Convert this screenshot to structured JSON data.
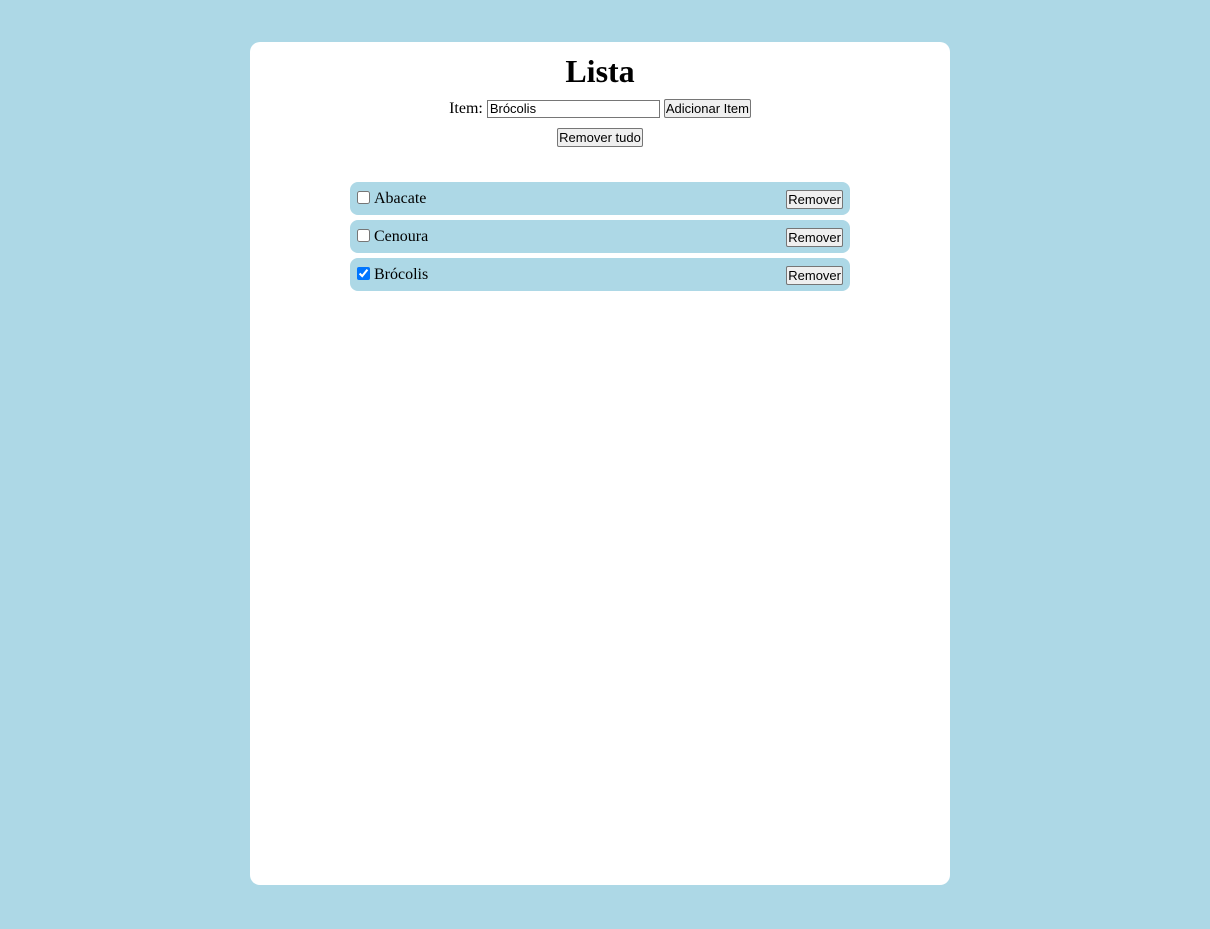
{
  "page": {
    "title": "Lista"
  },
  "form": {
    "item_label": "Item:",
    "item_value": "Brócolis",
    "add_button": "Adicionar Item",
    "remove_all_button": "Remover tudo"
  },
  "list": {
    "items": [
      {
        "label": "Abacate",
        "checked": false,
        "remove_label": "Remover"
      },
      {
        "label": "Cenoura",
        "checked": false,
        "remove_label": "Remover"
      },
      {
        "label": "Brócolis",
        "checked": true,
        "remove_label": "Remover"
      }
    ]
  },
  "colors": {
    "background": "#add8e6",
    "card": "#ffffff",
    "item_background": "#add8e6"
  }
}
